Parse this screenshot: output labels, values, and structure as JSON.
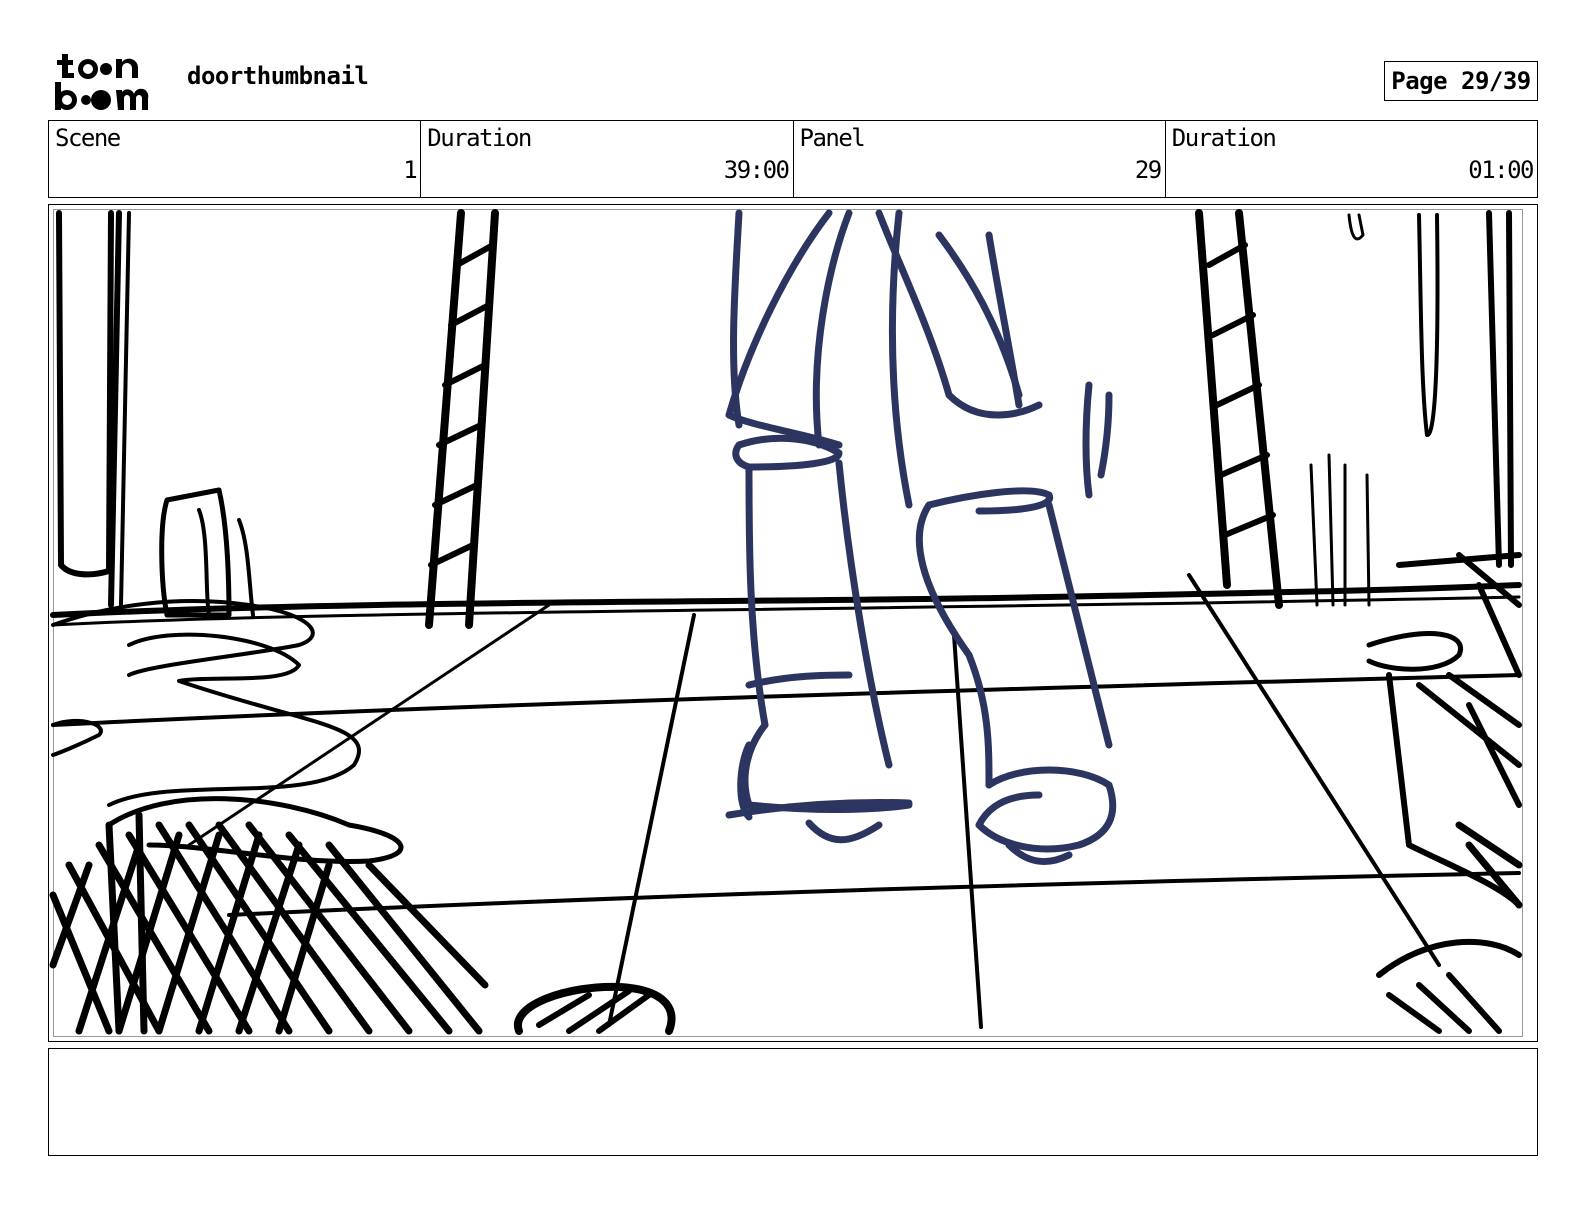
{
  "header": {
    "logo_top": "to•n",
    "logo_bottom": "b••m",
    "title": "doorthumbnail",
    "page": "Page 29/39"
  },
  "info": {
    "scene_label": "Scene",
    "scene_value": "1",
    "duration_label": "Duration",
    "duration_value": "39:00",
    "panel_label": "Panel",
    "panel_value": "29",
    "panel_duration_label": "Duration",
    "panel_duration_value": "01:00"
  },
  "panel": {
    "ink_color": "#000000",
    "figure_color": "#2c3560"
  },
  "notes": {
    "text": ""
  }
}
